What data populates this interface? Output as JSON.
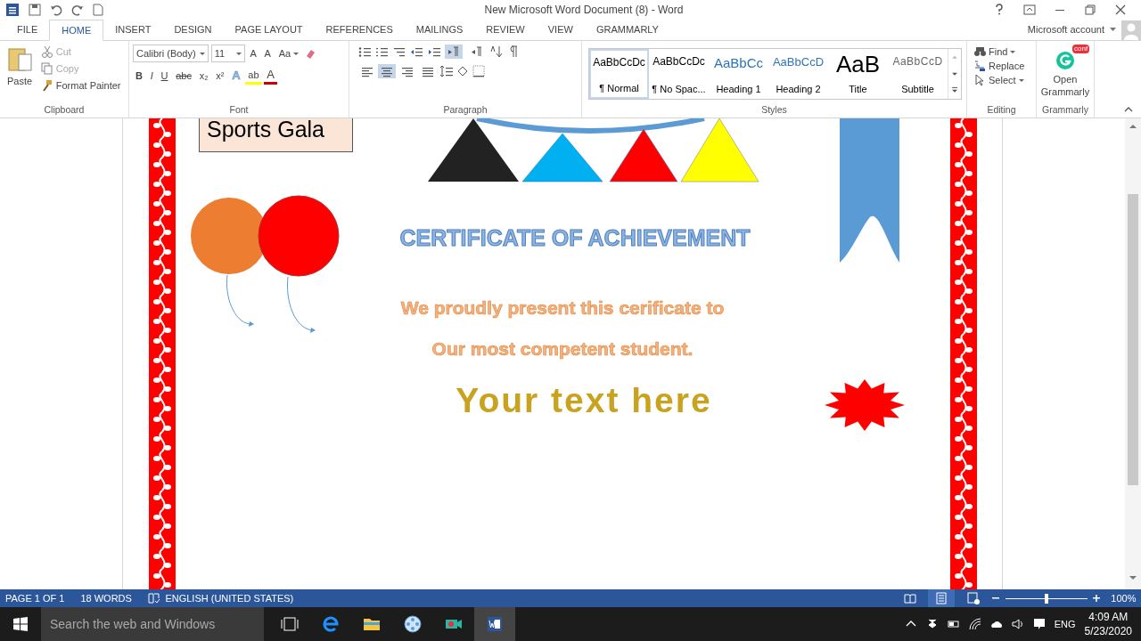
{
  "window": {
    "title": "New Microsoft Word Document (8) - Word",
    "account": "Microsoft account"
  },
  "tabs": [
    {
      "label": "FILE",
      "selected": false
    },
    {
      "label": "HOME",
      "selected": true
    },
    {
      "label": "INSERT",
      "selected": false
    },
    {
      "label": "DESIGN",
      "selected": false
    },
    {
      "label": "PAGE LAYOUT",
      "selected": false
    },
    {
      "label": "REFERENCES",
      "selected": false
    },
    {
      "label": "MAILINGS",
      "selected": false
    },
    {
      "label": "REVIEW",
      "selected": false
    },
    {
      "label": "VIEW",
      "selected": false
    },
    {
      "label": "GRAMMARLY",
      "selected": false
    }
  ],
  "ribbon": {
    "clipboard": {
      "label": "Clipboard",
      "paste": "Paste",
      "cut": "Cut",
      "copy": "Copy",
      "format_painter": "Format Painter"
    },
    "font": {
      "label": "Font",
      "name": "Calibri (Body)",
      "size": "11",
      "grow": "A",
      "shrink": "A",
      "case": "Aa",
      "format": [
        "B",
        "I",
        "U",
        "abc",
        "x₂",
        "x²"
      ],
      "effects": "A",
      "highlight": "ab",
      "font_color": "A"
    },
    "paragraph": {
      "label": "Paragraph",
      "direction": [
        {
          "selected": true
        },
        {
          "selected": false
        }
      ],
      "alignment": [
        {
          "selected": false
        },
        {
          "selected": true
        },
        {
          "selected": false
        },
        {
          "selected": false
        }
      ]
    },
    "styles": {
      "label": "Styles",
      "items": [
        {
          "preview": "AaBbCcDc",
          "name": "¶ Normal",
          "kind": "normal",
          "selected": true
        },
        {
          "preview": "AaBbCcDc",
          "name": "¶ No Spac...",
          "kind": "normal",
          "selected": false
        },
        {
          "preview": "AaBbCc",
          "name": "Heading 1",
          "kind": "heading1",
          "selected": false
        },
        {
          "preview": "AaBbCcD",
          "name": "Heading 2",
          "kind": "heading2",
          "selected": false
        },
        {
          "preview": "AaB",
          "name": "Title",
          "kind": "title",
          "selected": false
        },
        {
          "preview": "AaBbCcD",
          "name": "Subtitle",
          "kind": "subtitle",
          "selected": false
        }
      ]
    },
    "editing": {
      "label": "Editing",
      "find": "Find",
      "replace": "Replace",
      "select": "Select"
    },
    "grammarly": {
      "label": "Grammarly",
      "button": "Open Grammarly",
      "badge": "conf"
    }
  },
  "document": {
    "label_box": "Sports Gala",
    "heading": "CERTIFICATE OF ACHIEVEMENT",
    "lines": [
      "We proudly present this cerificate to",
      "Our most competent student."
    ],
    "name_line": "Your text here"
  },
  "status_bar": {
    "page": "PAGE 1 OF 1",
    "words": "18 WORDS",
    "language": "ENGLISH (UNITED STATES)",
    "views": [
      {
        "kind": "read",
        "selected": false
      },
      {
        "kind": "print",
        "selected": true
      },
      {
        "kind": "web",
        "selected": false
      }
    ],
    "zoom": {
      "level": 0.5,
      "reading": "100%"
    }
  },
  "taskbar": {
    "search_placeholder": "Search the web and Windows",
    "language": "ENG",
    "time": "4:09 AM",
    "date": "5/23/2020"
  }
}
